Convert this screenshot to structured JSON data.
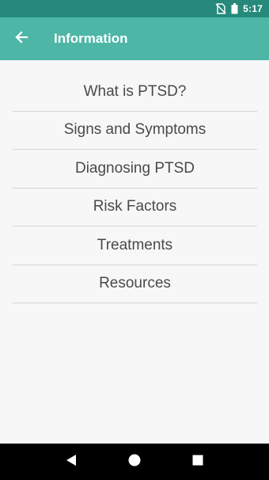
{
  "status_bar": {
    "time": "5:17",
    "icons": [
      "no-sim-icon",
      "battery-icon"
    ],
    "background": "#26897b"
  },
  "app_bar": {
    "title": "Information",
    "back_icon": "arrow-back-icon",
    "background": "#4db6a6"
  },
  "menu": {
    "items": [
      {
        "label": "What is PTSD?"
      },
      {
        "label": "Signs and Symptoms"
      },
      {
        "label": "Diagnosing PTSD"
      },
      {
        "label": "Risk Factors"
      },
      {
        "label": "Treatments"
      },
      {
        "label": "Resources"
      }
    ]
  },
  "nav_bar": {
    "icons": [
      "back-triangle-icon",
      "home-circle-icon",
      "recents-square-icon"
    ]
  }
}
